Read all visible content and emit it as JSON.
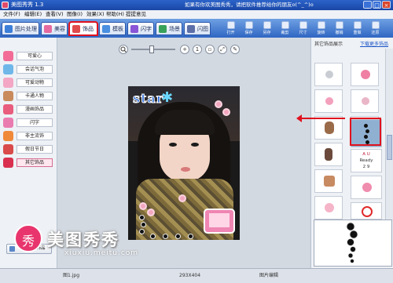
{
  "window": {
    "title": "美图秀秀 1.3",
    "message": "如果有你欢美图秀秀，请把软件推荐给你的朋友o(^_^)o"
  },
  "menu": [
    "文件(F)",
    "编辑(E)",
    "查看(V)",
    "图像(I)",
    "效果(X)",
    "帮助(H)",
    "提提意见"
  ],
  "tabs": [
    {
      "label": "图片处理",
      "color": "#3d7fd8"
    },
    {
      "label": "美容",
      "color": "#e56aa0"
    },
    {
      "label": "饰品",
      "color": "#e24b4b"
    },
    {
      "label": "模板",
      "color": "#4a8fe0"
    },
    {
      "label": "闪字",
      "color": "#8a55d6"
    },
    {
      "label": "场景",
      "color": "#39a25a"
    },
    {
      "label": "闪图",
      "color": "#5b6ea8"
    }
  ],
  "toolbar_buttons": [
    "打开",
    "保存",
    "另存",
    "裁剪",
    "尺寸",
    "旋转",
    "撤销",
    "重做",
    "还原"
  ],
  "sidebar": {
    "items": [
      {
        "label": "可爱心",
        "color": "#f26c97"
      },
      {
        "label": "会话气泡",
        "color": "#6fb7e9"
      },
      {
        "label": "可爱动物",
        "color": "#f3a7c4"
      },
      {
        "label": "卡通人物",
        "color": "#c98b5c"
      },
      {
        "label": "漫画饰品",
        "color": "#e85c7e"
      },
      {
        "label": "闪字",
        "color": "#ea7bb0"
      },
      {
        "label": "非主流饰",
        "color": "#f08a3b"
      },
      {
        "label": "假日节日",
        "color": "#d94a4a"
      },
      {
        "label": "其它饰品",
        "color": "#d9304f"
      }
    ],
    "selected": 8,
    "import_button": "导入更多饰品"
  },
  "canvas": {
    "zoom_level": 0.45,
    "photo_text": "star"
  },
  "right_panel": {
    "header": "其它饰品展示",
    "download_link": "下载更多饰品",
    "grid_items": [
      "bubble-sticker",
      "flower-sticker",
      "heart-sticker",
      "pink-deco-sticker",
      "girl-sticker",
      "chain-sticker",
      "figure-sticker",
      "dots-chain-sticker",
      "bag-sticker",
      "text-sticker",
      "flower-sticker-2",
      "pink-flower-sticker",
      "red-ornament-sticker",
      "red-swirl-sticker"
    ],
    "text_sticker": [
      "A U",
      "Ready",
      "2 9"
    ]
  },
  "status_bar": {
    "filename": "图1.jpg",
    "dimensions": "293X404",
    "mode": "图片编辑"
  },
  "watermark": {
    "logo_char": "秀",
    "title": "美图秀秀",
    "url": "xiuxiu.meitu.com"
  },
  "colors": {
    "highlight": "#e0121e",
    "titlebar": "#1a47a6"
  }
}
